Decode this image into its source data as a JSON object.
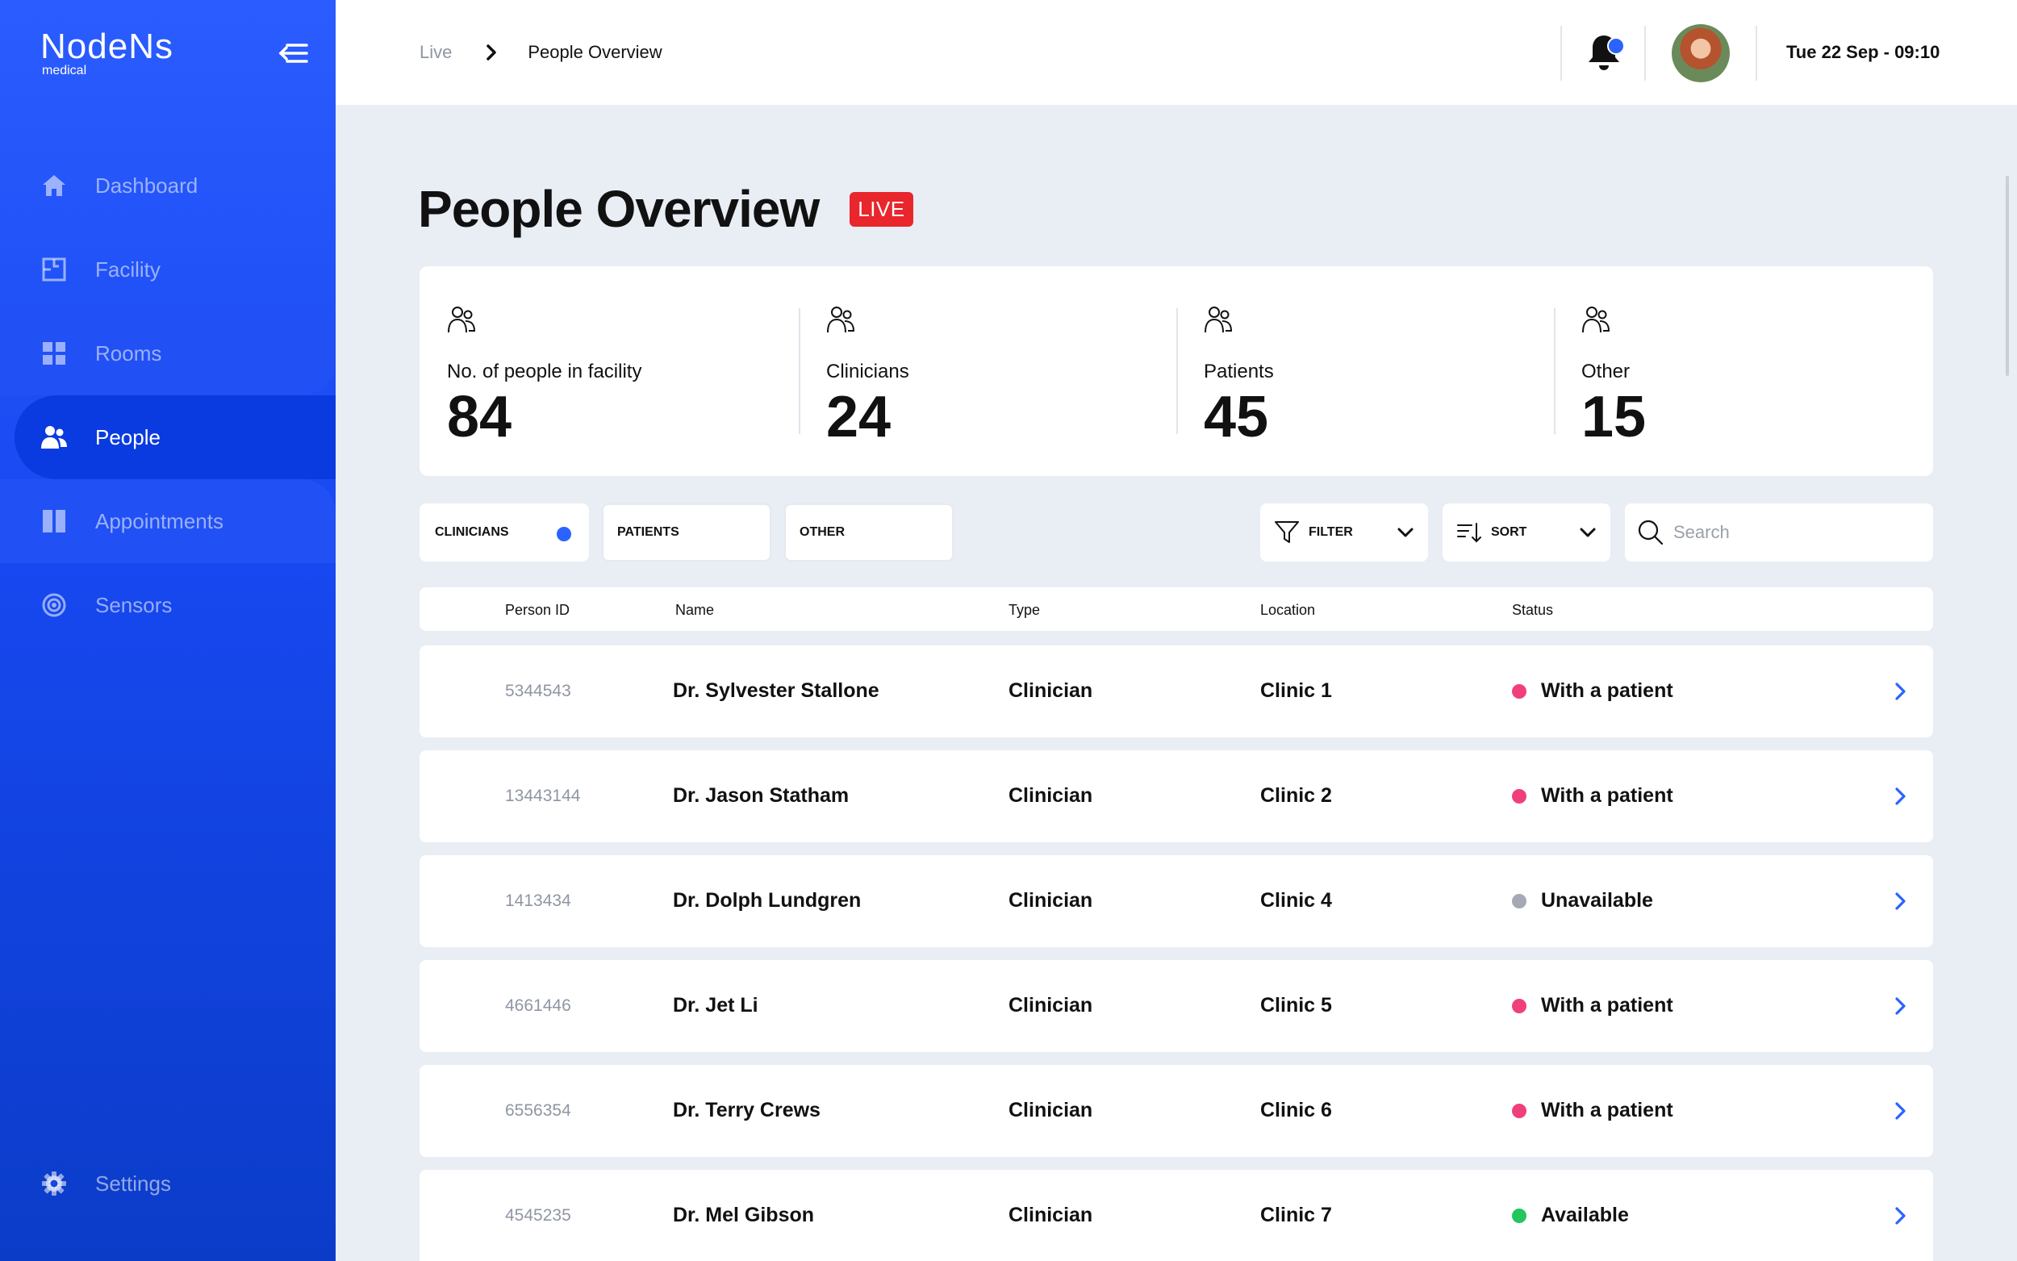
{
  "app": {
    "logo_main": "NodeNs",
    "logo_sub": "medical"
  },
  "sidebar": {
    "items": [
      {
        "label": "Dashboard",
        "icon": "home-icon"
      },
      {
        "label": "Facility",
        "icon": "facility-icon"
      },
      {
        "label": "Rooms",
        "icon": "grid-icon"
      },
      {
        "label": "People",
        "icon": "people-icon",
        "active": true
      },
      {
        "label": "Appointments",
        "icon": "columns-icon"
      },
      {
        "label": "Sensors",
        "icon": "target-icon"
      }
    ],
    "settings_label": "Settings"
  },
  "header": {
    "breadcrumb_root": "Live",
    "breadcrumb_current": "People Overview",
    "datetime": "Tue 22 Sep - 09:10",
    "notification_indicator": true
  },
  "page": {
    "title": "People Overview",
    "live_badge": "LIVE"
  },
  "stats": [
    {
      "label": "No. of people in facility",
      "value": "84"
    },
    {
      "label": "Clinicians",
      "value": "24"
    },
    {
      "label": "Patients",
      "value": "45"
    },
    {
      "label": "Other",
      "value": "15"
    }
  ],
  "tabs": [
    {
      "label": "CLINICIANS",
      "active": true
    },
    {
      "label": "PATIENTS",
      "active": false
    },
    {
      "label": "OTHER",
      "active": false
    }
  ],
  "controls": {
    "filter_label": "FILTER",
    "sort_label": "SORT",
    "search_placeholder": "Search",
    "search_value": ""
  },
  "table": {
    "columns": [
      "Person ID",
      "Name",
      "Type",
      "Location",
      "Status"
    ],
    "rows": [
      {
        "id": "5344543",
        "name": "Dr. Sylvester Stallone",
        "type": "Clinician",
        "location": "Clinic 1",
        "status": "With a patient",
        "status_color": "#f0407a"
      },
      {
        "id": "13443144",
        "name": "Dr. Jason Statham",
        "type": "Clinician",
        "location": "Clinic 2",
        "status": "With a patient",
        "status_color": "#f0407a"
      },
      {
        "id": "1413434",
        "name": "Dr. Dolph Lundgren",
        "type": "Clinician",
        "location": "Clinic 4",
        "status": "Unavailable",
        "status_color": "#a5a9b3"
      },
      {
        "id": "4661446",
        "name": "Dr. Jet Li",
        "type": "Clinician",
        "location": "Clinic 5",
        "status": "With a patient",
        "status_color": "#f0407a"
      },
      {
        "id": "6556354",
        "name": "Dr. Terry Crews",
        "type": "Clinician",
        "location": "Clinic 6",
        "status": "With a patient",
        "status_color": "#f0407a"
      },
      {
        "id": "4545235",
        "name": "Dr. Mel Gibson",
        "type": "Clinician",
        "location": "Clinic 7",
        "status": "Available",
        "status_color": "#22c55e"
      }
    ]
  },
  "colors": {
    "accent": "#2a63ff",
    "live": "#e8262c",
    "sidebar": "#1748f0"
  }
}
